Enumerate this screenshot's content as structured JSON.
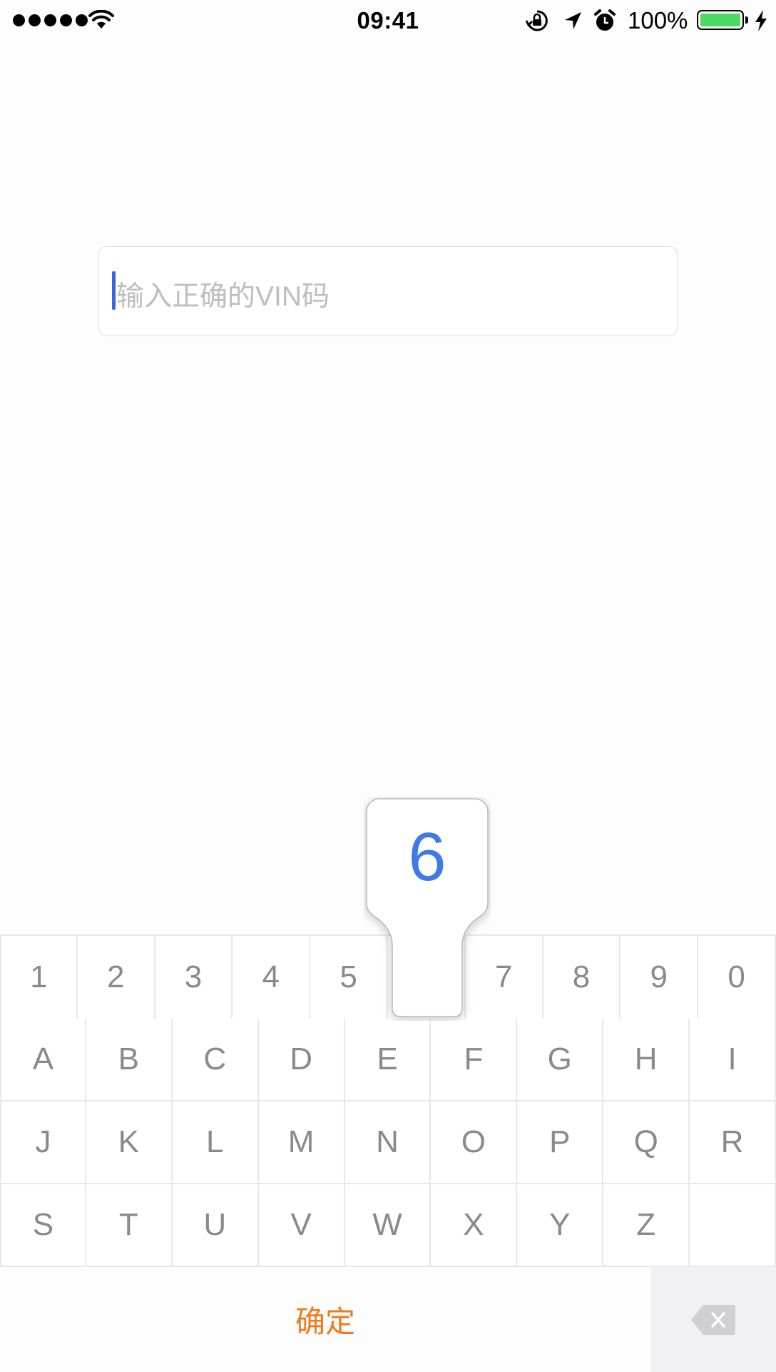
{
  "status_bar": {
    "time": "09:41",
    "battery_percent": "100%",
    "icons": [
      "signal-dots",
      "wifi-icon",
      "rotation-lock-icon",
      "location-arrow-icon",
      "alarm-icon",
      "battery-icon",
      "charging-bolt-icon"
    ]
  },
  "vin_input": {
    "placeholder": "输入正确的VIN码",
    "value": ""
  },
  "keyboard": {
    "row1": [
      "1",
      "2",
      "3",
      "4",
      "5",
      "",
      "7",
      "8",
      "9",
      "0"
    ],
    "row2": [
      "A",
      "B",
      "C",
      "D",
      "E",
      "F",
      "G",
      "H",
      "I"
    ],
    "row3": [
      "J",
      "K",
      "L",
      "M",
      "N",
      "O",
      "P",
      "Q",
      "R"
    ],
    "row4": [
      "S",
      "T",
      "U",
      "V",
      "W",
      "X",
      "Y",
      "Z",
      ""
    ],
    "pressed_key": "6",
    "confirm_label": "确定",
    "delete_icon": "backspace-icon"
  },
  "colors": {
    "accent_orange": "#f07a1c",
    "accent_blue": "#3f7ae8",
    "battery_green": "#4cd964"
  }
}
